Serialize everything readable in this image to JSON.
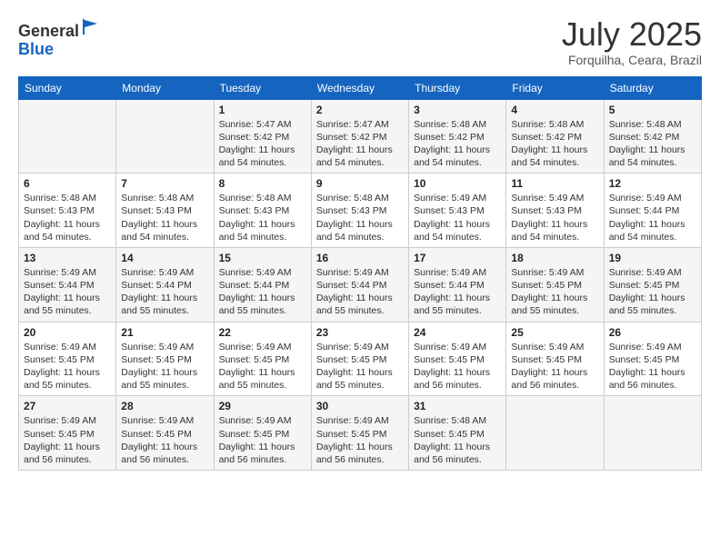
{
  "header": {
    "logo_line1": "General",
    "logo_line2": "Blue",
    "month": "July 2025",
    "location": "Forquilha, Ceara, Brazil"
  },
  "weekdays": [
    "Sunday",
    "Monday",
    "Tuesday",
    "Wednesday",
    "Thursday",
    "Friday",
    "Saturday"
  ],
  "weeks": [
    [
      {
        "day": "",
        "info": ""
      },
      {
        "day": "",
        "info": ""
      },
      {
        "day": "1",
        "info": "Sunrise: 5:47 AM\nSunset: 5:42 PM\nDaylight: 11 hours and 54 minutes."
      },
      {
        "day": "2",
        "info": "Sunrise: 5:47 AM\nSunset: 5:42 PM\nDaylight: 11 hours and 54 minutes."
      },
      {
        "day": "3",
        "info": "Sunrise: 5:48 AM\nSunset: 5:42 PM\nDaylight: 11 hours and 54 minutes."
      },
      {
        "day": "4",
        "info": "Sunrise: 5:48 AM\nSunset: 5:42 PM\nDaylight: 11 hours and 54 minutes."
      },
      {
        "day": "5",
        "info": "Sunrise: 5:48 AM\nSunset: 5:42 PM\nDaylight: 11 hours and 54 minutes."
      }
    ],
    [
      {
        "day": "6",
        "info": "Sunrise: 5:48 AM\nSunset: 5:43 PM\nDaylight: 11 hours and 54 minutes."
      },
      {
        "day": "7",
        "info": "Sunrise: 5:48 AM\nSunset: 5:43 PM\nDaylight: 11 hours and 54 minutes."
      },
      {
        "day": "8",
        "info": "Sunrise: 5:48 AM\nSunset: 5:43 PM\nDaylight: 11 hours and 54 minutes."
      },
      {
        "day": "9",
        "info": "Sunrise: 5:48 AM\nSunset: 5:43 PM\nDaylight: 11 hours and 54 minutes."
      },
      {
        "day": "10",
        "info": "Sunrise: 5:49 AM\nSunset: 5:43 PM\nDaylight: 11 hours and 54 minutes."
      },
      {
        "day": "11",
        "info": "Sunrise: 5:49 AM\nSunset: 5:43 PM\nDaylight: 11 hours and 54 minutes."
      },
      {
        "day": "12",
        "info": "Sunrise: 5:49 AM\nSunset: 5:44 PM\nDaylight: 11 hours and 54 minutes."
      }
    ],
    [
      {
        "day": "13",
        "info": "Sunrise: 5:49 AM\nSunset: 5:44 PM\nDaylight: 11 hours and 55 minutes."
      },
      {
        "day": "14",
        "info": "Sunrise: 5:49 AM\nSunset: 5:44 PM\nDaylight: 11 hours and 55 minutes."
      },
      {
        "day": "15",
        "info": "Sunrise: 5:49 AM\nSunset: 5:44 PM\nDaylight: 11 hours and 55 minutes."
      },
      {
        "day": "16",
        "info": "Sunrise: 5:49 AM\nSunset: 5:44 PM\nDaylight: 11 hours and 55 minutes."
      },
      {
        "day": "17",
        "info": "Sunrise: 5:49 AM\nSunset: 5:44 PM\nDaylight: 11 hours and 55 minutes."
      },
      {
        "day": "18",
        "info": "Sunrise: 5:49 AM\nSunset: 5:45 PM\nDaylight: 11 hours and 55 minutes."
      },
      {
        "day": "19",
        "info": "Sunrise: 5:49 AM\nSunset: 5:45 PM\nDaylight: 11 hours and 55 minutes."
      }
    ],
    [
      {
        "day": "20",
        "info": "Sunrise: 5:49 AM\nSunset: 5:45 PM\nDaylight: 11 hours and 55 minutes."
      },
      {
        "day": "21",
        "info": "Sunrise: 5:49 AM\nSunset: 5:45 PM\nDaylight: 11 hours and 55 minutes."
      },
      {
        "day": "22",
        "info": "Sunrise: 5:49 AM\nSunset: 5:45 PM\nDaylight: 11 hours and 55 minutes."
      },
      {
        "day": "23",
        "info": "Sunrise: 5:49 AM\nSunset: 5:45 PM\nDaylight: 11 hours and 55 minutes."
      },
      {
        "day": "24",
        "info": "Sunrise: 5:49 AM\nSunset: 5:45 PM\nDaylight: 11 hours and 56 minutes."
      },
      {
        "day": "25",
        "info": "Sunrise: 5:49 AM\nSunset: 5:45 PM\nDaylight: 11 hours and 56 minutes."
      },
      {
        "day": "26",
        "info": "Sunrise: 5:49 AM\nSunset: 5:45 PM\nDaylight: 11 hours and 56 minutes."
      }
    ],
    [
      {
        "day": "27",
        "info": "Sunrise: 5:49 AM\nSunset: 5:45 PM\nDaylight: 11 hours and 56 minutes."
      },
      {
        "day": "28",
        "info": "Sunrise: 5:49 AM\nSunset: 5:45 PM\nDaylight: 11 hours and 56 minutes."
      },
      {
        "day": "29",
        "info": "Sunrise: 5:49 AM\nSunset: 5:45 PM\nDaylight: 11 hours and 56 minutes."
      },
      {
        "day": "30",
        "info": "Sunrise: 5:49 AM\nSunset: 5:45 PM\nDaylight: 11 hours and 56 minutes."
      },
      {
        "day": "31",
        "info": "Sunrise: 5:48 AM\nSunset: 5:45 PM\nDaylight: 11 hours and 56 minutes."
      },
      {
        "day": "",
        "info": ""
      },
      {
        "day": "",
        "info": ""
      }
    ]
  ]
}
